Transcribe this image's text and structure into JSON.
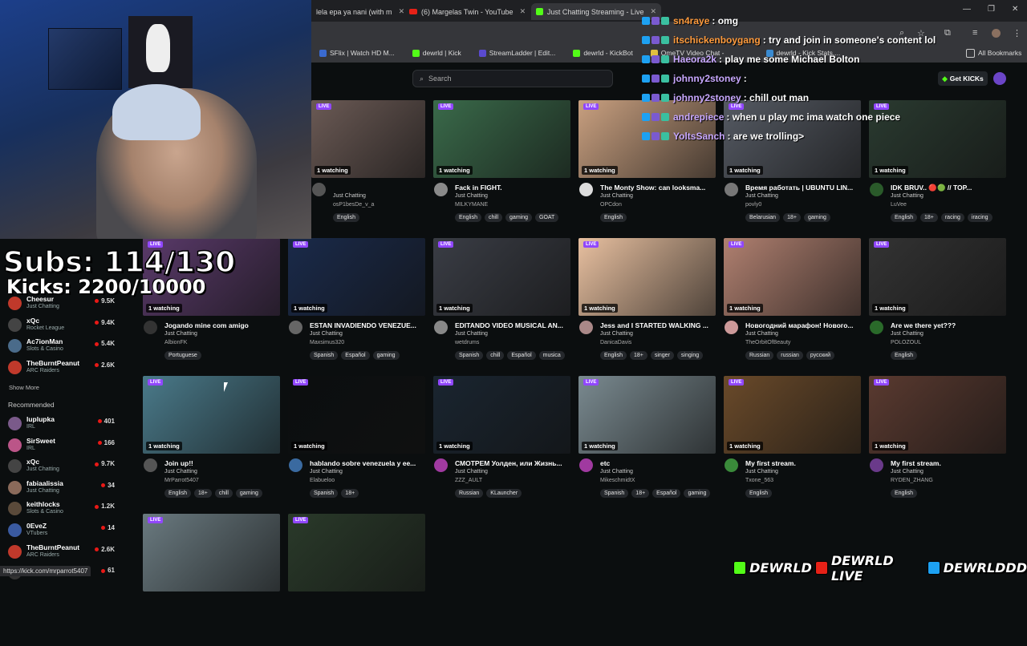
{
  "browser": {
    "tabs": [
      {
        "label": "lela epa ya nani (with m",
        "icon": "page-icon"
      },
      {
        "label": "(6) Margelas Twin - YouTube",
        "icon": "youtube-icon"
      },
      {
        "label": "Just Chatting Streaming - Live",
        "icon": "kick-icon"
      }
    ],
    "bookmarks": [
      "SFlix | Watch HD M...",
      "dewrld | Kick",
      "StreamLadder | Edit...",
      "dewrld - KickBot",
      "OmeTV Video Chat -",
      "dewrld - Kick Stats,...",
      "All Bookmarks"
    ],
    "status_url": "https://kick.com/mrparrot5407"
  },
  "overlay": {
    "subs": "Subs: 114/130",
    "kicks": "Kicks: 2200/10000",
    "brand": [
      "DEWRLD",
      "DEWRLD LIVE",
      "DEWRLDDD"
    ]
  },
  "header": {
    "search_placeholder": "Search",
    "get_kicks": "Get KICKs"
  },
  "chat": [
    {
      "user": "sn4raye",
      "message": ": omg",
      "color": "#ff9b3d"
    },
    {
      "user": "itschickenboygang",
      "message": ": try and join in someone's content lol",
      "color": "#ff9b3d"
    },
    {
      "user": "Haeora2k",
      "message": ": play me some Michael Bolton",
      "color": "#c8a8ff"
    },
    {
      "user": "johnny2stoney",
      "message": ":",
      "color": "#c8a8ff"
    },
    {
      "user": "johnny2stoney",
      "message": ": chill out man",
      "color": "#c8a8ff"
    },
    {
      "user": "andrepiece",
      "message": ": when u play mc ima watch one piece",
      "color": "#c8a8ff"
    },
    {
      "user": "YoltsSanch",
      "message": ": are we trolling>",
      "color": "#c8a8ff"
    }
  ],
  "sidebar": {
    "following": [
      {
        "name": "Cheesur",
        "category": "Just Chatting",
        "count": "9.5K",
        "color": "#c0392b"
      },
      {
        "name": "xQc",
        "category": "Rocket League",
        "count": "9.4K",
        "color": "#444"
      },
      {
        "name": "Ac7ionMan",
        "category": "Slots & Casino",
        "count": "5.4K",
        "color": "#4a6b8a"
      },
      {
        "name": "TheBurntPeanut",
        "category": "ARC Raiders",
        "count": "2.6K",
        "color": "#c0392b"
      }
    ],
    "show_more": "Show More",
    "recommended_title": "Recommended",
    "recommended": [
      {
        "name": "luplupka",
        "category": "IRL",
        "count": "401",
        "color": "#7a5a8a"
      },
      {
        "name": "SirSweet",
        "category": "IRL",
        "count": "166",
        "color": "#b58"
      },
      {
        "name": "xQc",
        "category": "Just Chatting",
        "count": "9.7K",
        "color": "#444"
      },
      {
        "name": "fabiaalissia",
        "category": "Just Chatting",
        "count": "34",
        "color": "#8a6a5a"
      },
      {
        "name": "keithlocks",
        "category": "Slots & Casino",
        "count": "1.2K",
        "color": "#5a4a3a"
      },
      {
        "name": "0EveZ",
        "category": "VTubers",
        "count": "14",
        "color": "#3a5aa0"
      },
      {
        "name": "TheBurntPeanut",
        "category": "ARC Raiders",
        "count": "2.6K",
        "color": "#c0392b"
      },
      {
        "name": "",
        "category": "",
        "count": "61",
        "color": "#333"
      }
    ]
  },
  "streams": [
    {
      "title": "",
      "category": "Just Chatting",
      "user": "osP1besDe_v_a",
      "watching": "1 watching",
      "tags": [
        "English"
      ],
      "thumb": "#6b5a55",
      "av": "#555"
    },
    {
      "title": "Fack in FIGHT.",
      "category": "Just Chatting",
      "user": "MILKYMANE",
      "watching": "1 watching",
      "tags": [
        "English",
        "chill",
        "gaming",
        "GOAT"
      ],
      "thumb": "#3a6a4a",
      "av": "#8a8a8a"
    },
    {
      "title": "The Monty Show: can looksma...",
      "category": "Just Chatting",
      "user": "OPCdon",
      "watching": "1 watching",
      "tags": [
        "English"
      ],
      "thumb": "#c9a080",
      "av": "#ddd"
    },
    {
      "title": "Время работать | UBUNTU LIN...",
      "category": "Just Chatting",
      "user": "povly0",
      "watching": "1 watching",
      "tags": [
        "Belarusian",
        "18+",
        "gaming"
      ],
      "thumb": "#555a63",
      "av": "#777"
    },
    {
      "title": "IDK BRUV.. 🔴🟢 // TOP...",
      "category": "Just Chatting",
      "user": "LuVee",
      "watching": "1 watching",
      "tags": [
        "English",
        "18+",
        "racing",
        "iracing"
      ],
      "thumb": "#2a3a30",
      "av": "#2a5a2a"
    },
    {
      "title": "Jogando mine com amigo",
      "category": "Just Chatting",
      "user": "AlbionFK",
      "watching": "1 watching",
      "tags": [
        "Portuguese"
      ],
      "thumb": "#5a3a6a",
      "av": "#333"
    },
    {
      "title": "ESTAN INVADIENDO VENEZUE...",
      "category": "Just Chatting",
      "user": "Maxsimus320",
      "watching": "1 watching",
      "tags": [
        "Spanish",
        "Español",
        "gaming"
      ],
      "thumb": "#1a2a4a",
      "av": "#666"
    },
    {
      "title": "EDITANDO VIDEO MUSICAL AN...",
      "category": "Just Chatting",
      "user": "wetdrums",
      "watching": "1 watching",
      "tags": [
        "Spanish",
        "chill",
        "Español",
        "musica"
      ],
      "thumb": "#3a3d45",
      "av": "#888"
    },
    {
      "title": "Jess and I STARTED WALKING ...",
      "category": "Just Chatting",
      "user": "DanicaDavis",
      "watching": "1 watching",
      "tags": [
        "English",
        "18+",
        "singer",
        "singing"
      ],
      "thumb": "#e8c0a0",
      "av": "#a88"
    },
    {
      "title": "Новогодний марафон! Нового...",
      "category": "Just Chatting",
      "user": "TheOrbitOfBeauty",
      "watching": "1 watching",
      "tags": [
        "Russian",
        "russian",
        "русский"
      ],
      "thumb": "#b08070",
      "av": "#c99"
    },
    {
      "title": "Are we there yet???",
      "category": "Just Chatting",
      "user": "POLOZOUL",
      "watching": "1 watching",
      "tags": [
        "English"
      ],
      "thumb": "#333",
      "av": "#2a6a2a"
    },
    {
      "title": "Join up!!",
      "category": "Just Chatting",
      "user": "MrParrot5407",
      "watching": "1 watching",
      "tags": [
        "English",
        "18+",
        "chill",
        "gaming"
      ],
      "thumb": "#4a7a8a",
      "av": "#555"
    },
    {
      "title": "hablando sobre venezuela y ee...",
      "category": "Just Chatting",
      "user": "Elabueloo",
      "watching": "1 watching",
      "tags": [
        "Spanish",
        "18+"
      ],
      "thumb": "#0b0e0f",
      "av": "#3a6aa0"
    },
    {
      "title": "СМОТРЕМ Уолден, или Жизнь...",
      "category": "Just Chatting",
      "user": "ZZZ_AULT",
      "watching": "1 watching",
      "tags": [
        "Russian",
        "KLauncher"
      ],
      "thumb": "#1a2530",
      "av": "#a03aa0"
    },
    {
      "title": "etc",
      "category": "Just Chatting",
      "user": "MikeschmidtX",
      "watching": "1 watching",
      "tags": [
        "Spanish",
        "18+",
        "Español",
        "gaming"
      ],
      "thumb": "#7a8a90",
      "av": "#a03aa0"
    },
    {
      "title": "My first stream.",
      "category": "Just Chatting",
      "user": "Txone_563",
      "watching": "1 watching",
      "tags": [
        "English"
      ],
      "thumb": "#6a4a2a",
      "av": "#3a8a3a"
    },
    {
      "title": "My first stream.",
      "category": "Just Chatting",
      "user": "RYDEN_ZHANG",
      "watching": "1 watching",
      "tags": [
        "English"
      ],
      "thumb": "#5a3a30",
      "av": "#6a3a8a"
    },
    {
      "title": "",
      "category": "",
      "user": "",
      "watching": "",
      "tags": [],
      "thumb": "#6a7a80",
      "av": "#333"
    },
    {
      "title": "",
      "category": "",
      "user": "",
      "watching": "",
      "tags": [],
      "thumb": "#2a3a2a",
      "av": "#333"
    }
  ]
}
